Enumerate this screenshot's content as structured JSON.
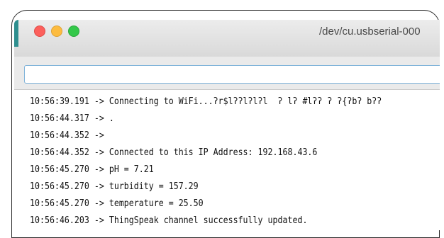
{
  "window": {
    "title": "/dev/cu.usbserial-000",
    "accent_color": "#2f8f8f"
  },
  "send_input": {
    "value": ""
  },
  "console": {
    "lines": [
      "10:56:39.191 -> Connecting to WiFi...ʔr$lʔʔlʔlʔl  ʔ lʔ #lʔʔ ʔ ʔ{ʔbʔ bʔʔ",
      "10:56:44.317 -> .",
      "10:56:44.352 -> ",
      "10:56:44.352 -> Connected to this IP Address: 192.168.43.6",
      "10:56:45.270 -> pH = 7.21",
      "10:56:45.270 -> turbidity = 157.29",
      "10:56:45.270 -> temperature = 25.50",
      "10:56:46.203 -> ThingSpeak channel successfully updated."
    ]
  }
}
